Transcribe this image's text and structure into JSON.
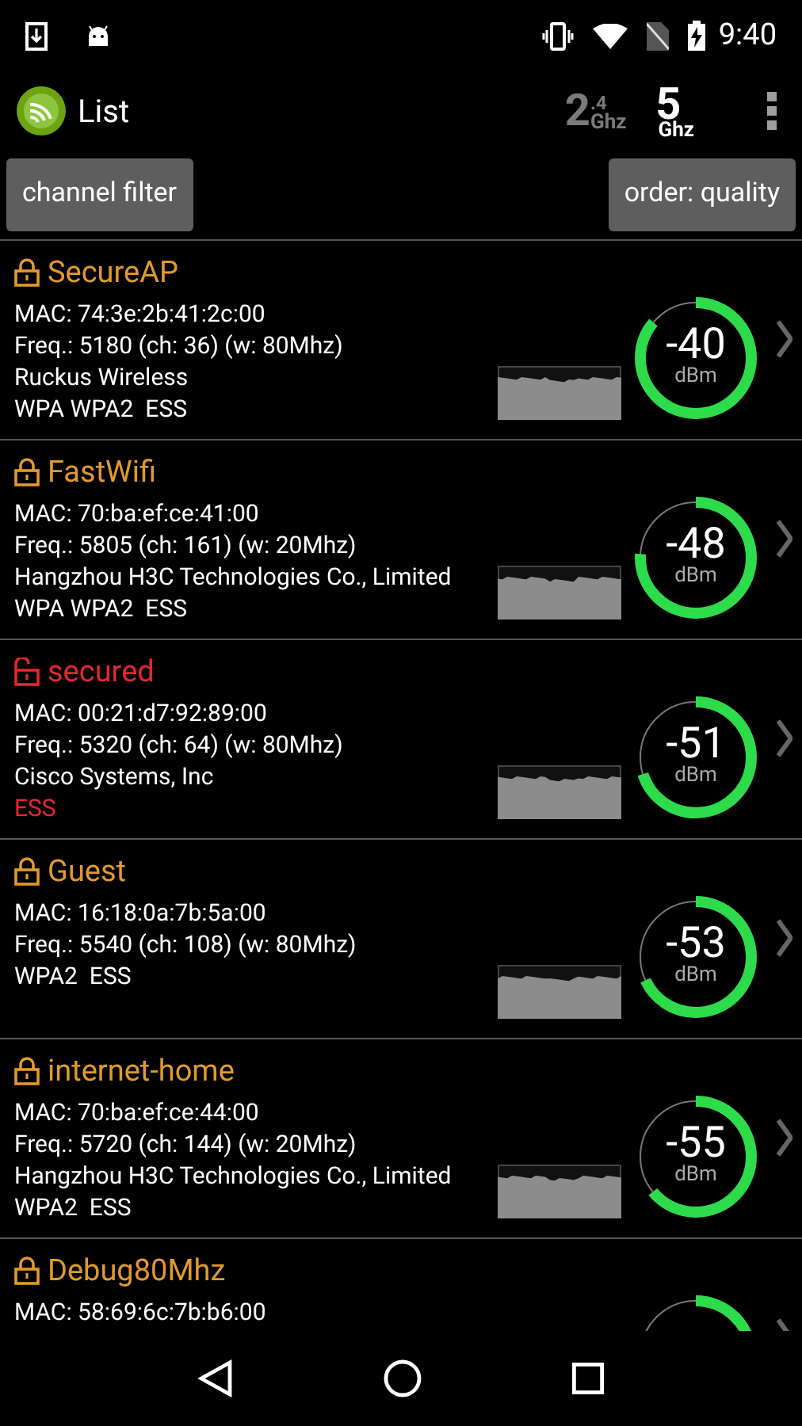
{
  "status_bar": {
    "time": "9:40"
  },
  "toolbar": {
    "title": "List",
    "band_24": {
      "main": "2",
      "sub": ".4",
      "unit": "Ghz",
      "selected": false
    },
    "band_5": {
      "main": "5",
      "unit": "Ghz",
      "selected": true
    }
  },
  "buttons": [
    "channel filter",
    "order: quality"
  ],
  "networks": [
    {
      "ssid": "SecureAP",
      "open": false,
      "mac": "MAC: 74:3e:2b:41:2c:00",
      "freq": "Freq.: 5180 (ch: 36) (w: 80Mhz)",
      "vendor": "Ruckus Wireless",
      "security": "WPA WPA2  ESS",
      "rssi": "-40",
      "unit": "dBm",
      "level": 0.86
    },
    {
      "ssid": "FastWifi",
      "open": false,
      "mac": "MAC: 70:ba:ef:ce:41:00",
      "freq": "Freq.: 5805 (ch: 161) (w: 20Mhz)",
      "vendor": "Hangzhou H3C Technologies Co., Limited",
      "security": "WPA WPA2  ESS",
      "rssi": "-48",
      "unit": "dBm",
      "level": 0.76
    },
    {
      "ssid": "secured",
      "open": true,
      "mac": "MAC: 00:21:d7:92:89:00",
      "freq": "Freq.: 5320 (ch: 64) (w: 80Mhz)",
      "vendor": "Cisco Systems, Inc",
      "security": "ESS",
      "rssi": "-51",
      "unit": "dBm",
      "level": 0.7
    },
    {
      "ssid": "Guest",
      "open": false,
      "mac": "MAC: 16:18:0a:7b:5a:00",
      "freq": "Freq.: 5540 (ch: 108) (w: 80Mhz)",
      "security": "WPA2  ESS",
      "rssi": "-53",
      "unit": "dBm",
      "level": 0.68
    },
    {
      "ssid": "internet-home",
      "open": false,
      "mac": "MAC: 70:ba:ef:ce:44:00",
      "freq": "Freq.: 5720 (ch: 144) (w: 20Mhz)",
      "vendor": "Hangzhou H3C Technologies Co., Limited",
      "security": "WPA2  ESS",
      "rssi": "-55",
      "unit": "dBm",
      "level": 0.64
    },
    {
      "ssid": "Debug80Mhz",
      "open": false,
      "mac": "MAC: 58:69:6c:7b:b6:00"
    }
  ]
}
